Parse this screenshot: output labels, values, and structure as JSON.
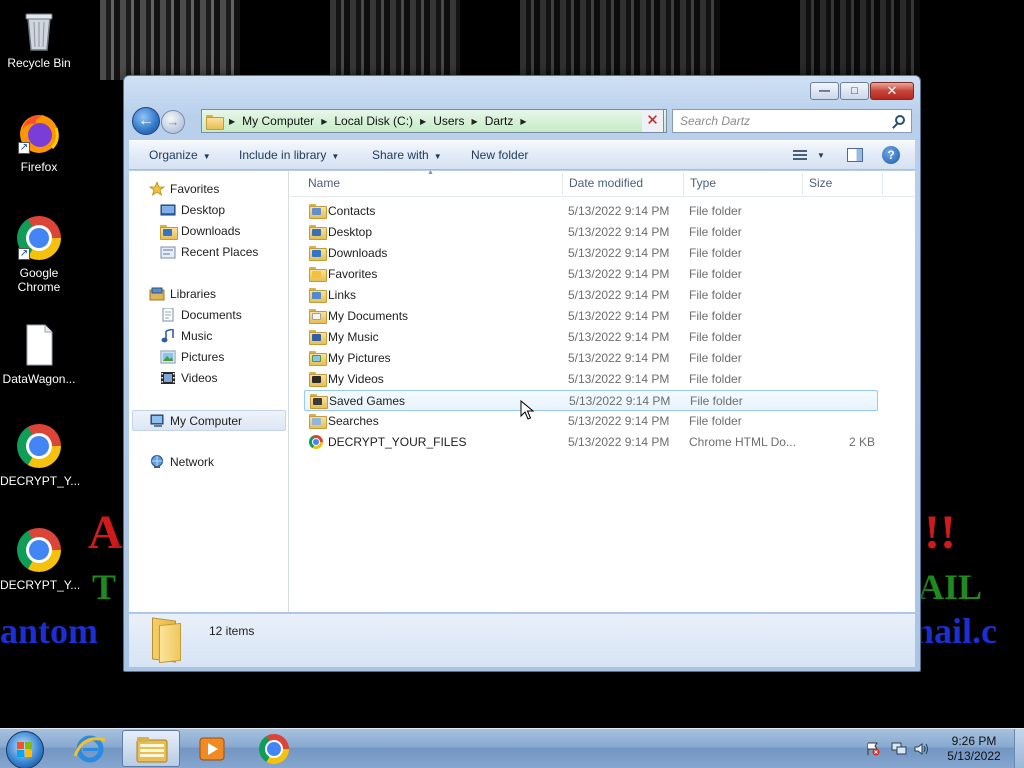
{
  "wallpaper": {
    "line1_left": "A",
    "line1_right": "!!",
    "line2_left": "T",
    "line2_right": "AIL",
    "line3_left": "antom",
    "line3_right": "nail.c"
  },
  "desktop_icons": [
    {
      "label": "Recycle Bin",
      "icon": "recycle-bin-icon"
    },
    {
      "label": "Firefox",
      "icon": "firefox-icon"
    },
    {
      "label": "Google Chrome",
      "icon": "chrome-icon"
    },
    {
      "label": "DataWagon...",
      "icon": "file-icon"
    },
    {
      "label": "DECRYPT_Y...",
      "icon": "chrome-icon"
    },
    {
      "label": "DECRYPT_Y...",
      "icon": "chrome-icon"
    }
  ],
  "window": {
    "caption": {
      "minimize": "—",
      "maximize": "□",
      "close": "✕"
    },
    "breadcrumb": [
      "My Computer",
      "Local Disk (C:)",
      "Users",
      "Dartz"
    ],
    "search_placeholder": "Search Dartz",
    "toolbar": {
      "organize": "Organize",
      "include_in_library": "Include in library",
      "share_with": "Share with",
      "new_folder": "New folder",
      "help": "?"
    },
    "nav": {
      "favorites": "Favorites",
      "favorites_items": [
        "Desktop",
        "Downloads",
        "Recent Places"
      ],
      "libraries": "Libraries",
      "libraries_items": [
        "Documents",
        "Music",
        "Pictures",
        "Videos"
      ],
      "computer": "My Computer",
      "network": "Network"
    },
    "columns": {
      "name": "Name",
      "date": "Date modified",
      "type": "Type",
      "size": "Size"
    },
    "files": [
      {
        "name": "Contacts",
        "date": "5/13/2022 9:14 PM",
        "type": "File folder",
        "size": ""
      },
      {
        "name": "Desktop",
        "date": "5/13/2022 9:14 PM",
        "type": "File folder",
        "size": ""
      },
      {
        "name": "Downloads",
        "date": "5/13/2022 9:14 PM",
        "type": "File folder",
        "size": ""
      },
      {
        "name": "Favorites",
        "date": "5/13/2022 9:14 PM",
        "type": "File folder",
        "size": ""
      },
      {
        "name": "Links",
        "date": "5/13/2022 9:14 PM",
        "type": "File folder",
        "size": ""
      },
      {
        "name": "My Documents",
        "date": "5/13/2022 9:14 PM",
        "type": "File folder",
        "size": ""
      },
      {
        "name": "My Music",
        "date": "5/13/2022 9:14 PM",
        "type": "File folder",
        "size": ""
      },
      {
        "name": "My Pictures",
        "date": "5/13/2022 9:14 PM",
        "type": "File folder",
        "size": ""
      },
      {
        "name": "My Videos",
        "date": "5/13/2022 9:14 PM",
        "type": "File folder",
        "size": ""
      },
      {
        "name": "Saved Games",
        "date": "5/13/2022 9:14 PM",
        "type": "File folder",
        "size": ""
      },
      {
        "name": "Searches",
        "date": "5/13/2022 9:14 PM",
        "type": "File folder",
        "size": ""
      },
      {
        "name": "DECRYPT_YOUR_FILES",
        "date": "5/13/2022 9:14 PM",
        "type": "Chrome HTML Do...",
        "size": "2 KB"
      }
    ],
    "details": {
      "item_count": "12 items"
    }
  },
  "taskbar": {
    "time": "9:26 PM",
    "date": "5/13/2022",
    "pinned": [
      "internet-explorer-icon",
      "windows-explorer-icon",
      "media-player-icon",
      "chrome-icon"
    ]
  },
  "colors": {
    "hover_row_border": "#99c9ef",
    "address_bar_green": "#c3ecc6",
    "wallpaper_red": "#d11a1a",
    "wallpaper_green": "#1f8a1f",
    "wallpaper_blue": "#1b2fd6"
  }
}
